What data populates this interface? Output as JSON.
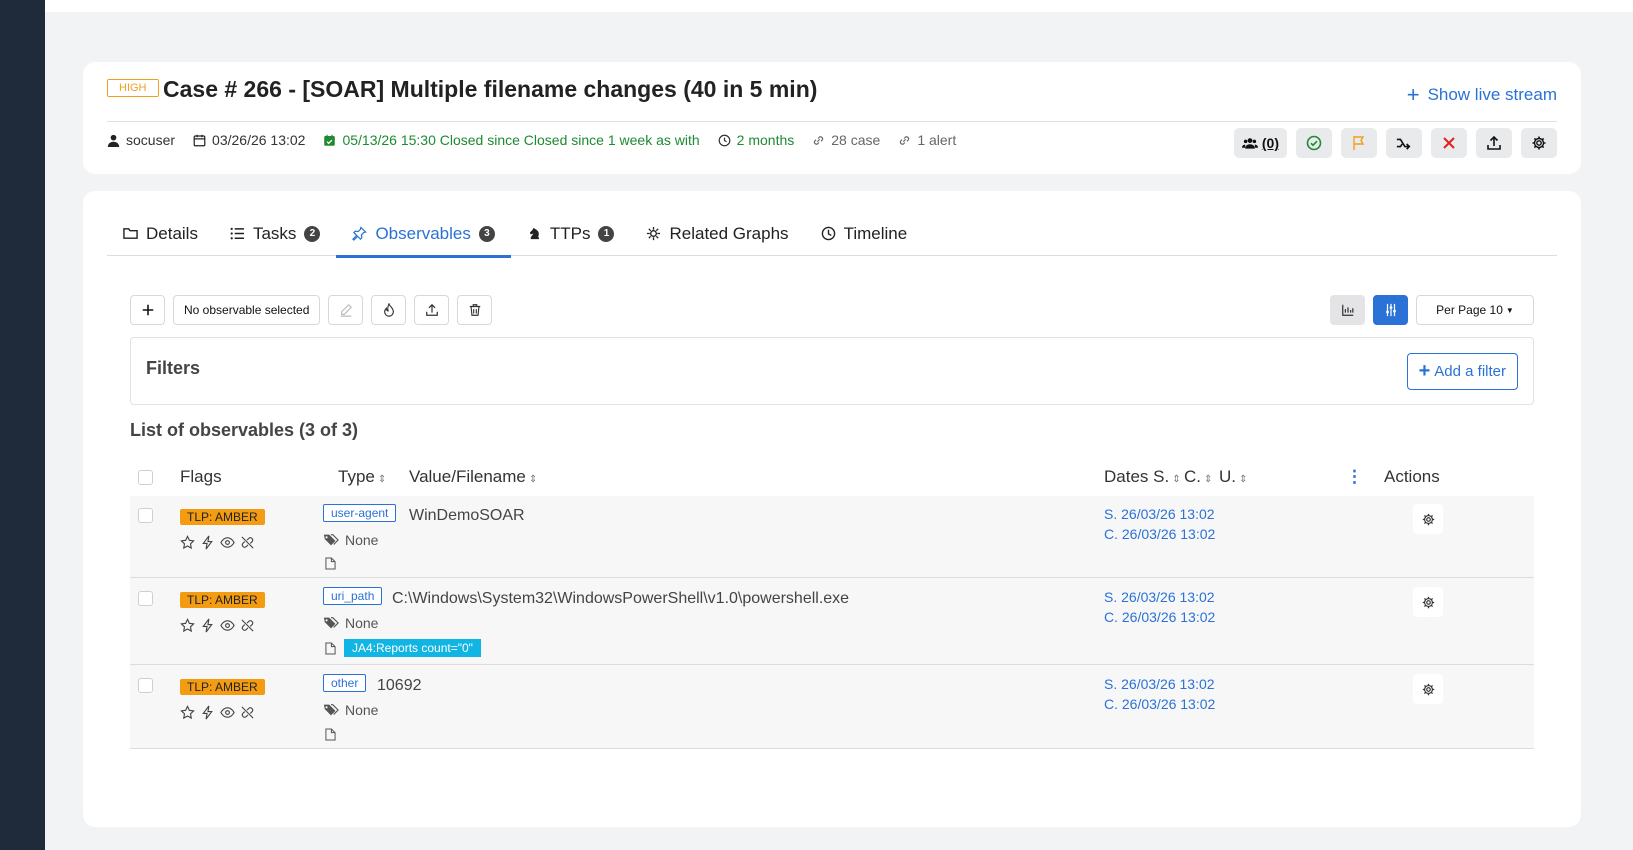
{
  "case": {
    "severity": "HIGH",
    "title": "Case # 266 - [SOAR] Multiple filename changes (40 in 5 min)",
    "live_stream": "Show live stream",
    "meta": {
      "user": "socuser",
      "created": "03/26/26 13:02",
      "closed": "05/13/26 15:30 Closed since Closed since 1 week as  with",
      "duration": "2 months",
      "cases": "28 case",
      "alerts": "1 alert"
    },
    "owners_count": "(0)"
  },
  "tabs": [
    {
      "label": "Details",
      "icon": "folder-icon",
      "count": ""
    },
    {
      "label": "Tasks",
      "icon": "list-icon",
      "count": "2"
    },
    {
      "label": "Observables",
      "icon": "pin-icon",
      "count": "3"
    },
    {
      "label": "TTPs",
      "icon": "chess-knight-icon",
      "count": "1"
    },
    {
      "label": "Related Graphs",
      "icon": "network-icon",
      "count": ""
    },
    {
      "label": "Timeline",
      "icon": "clock-icon",
      "count": ""
    }
  ],
  "toolbar": {
    "selection_label": "No observable selected",
    "per_page": "Per Page 10"
  },
  "filters": {
    "title": "Filters",
    "add_label": "Add a filter"
  },
  "list": {
    "title": "List of observables (3 of 3)",
    "columns": {
      "flags": "Flags",
      "type": "Type",
      "value": "Value/Filename",
      "dates": "Dates S.",
      "created": "C.",
      "updated": "U.",
      "actions": "Actions"
    },
    "rows": [
      {
        "tlp": "TLP: AMBER",
        "type": "user-agent",
        "value": "WinDemoSOAR",
        "tags": "None",
        "attachment": "",
        "start": "S. 26/03/26 13:02",
        "created": "C. 26/03/26 13:02"
      },
      {
        "tlp": "TLP: AMBER",
        "type": "uri_path",
        "value": "C:\\Windows\\System32\\WindowsPowerShell\\v1.0\\powershell.exe",
        "tags": "None",
        "attachment": "JA4:Reports count=\"0\"",
        "start": "S. 26/03/26 13:02",
        "created": "C. 26/03/26 13:02"
      },
      {
        "tlp": "TLP: AMBER",
        "type": "other",
        "value": "10692",
        "tags": "None",
        "attachment": "",
        "start": "S. 26/03/26 13:02",
        "created": "C. 26/03/26 13:02"
      }
    ]
  },
  "colors": {
    "accent": "#2a72d6",
    "amber": "#f39c12",
    "success": "#1e8a32",
    "danger": "#e02020",
    "sidebar": "#1f2b3a"
  }
}
